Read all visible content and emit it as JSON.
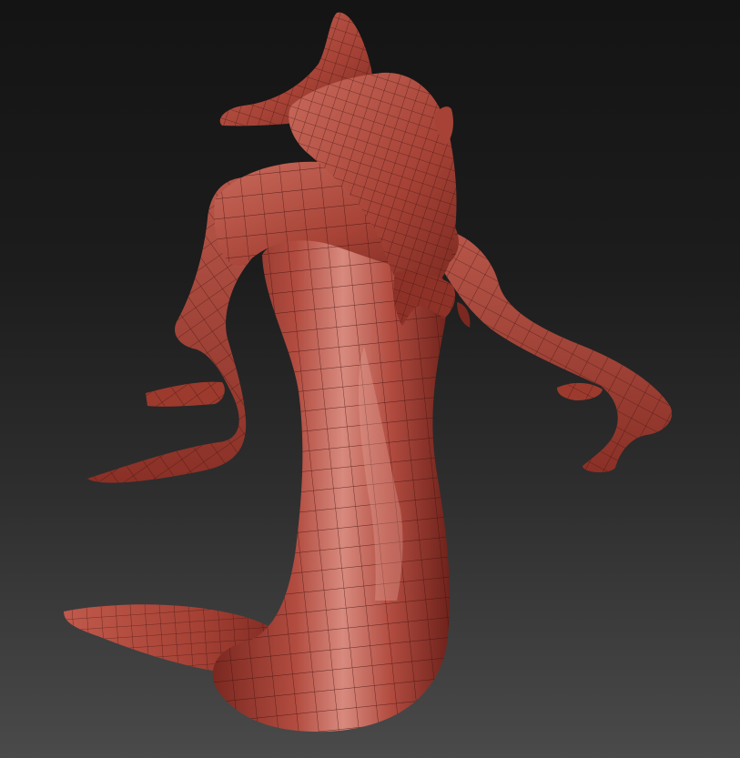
{
  "viewport": {
    "background_top": "#161616",
    "background_bottom": "#4a4a4a"
  },
  "model": {
    "subject": "serpent-creature-sculpt",
    "display": "polygroup-wireframe",
    "base_color": "#a84438",
    "highlight_color": "#d9857a",
    "shadow_color": "#5a1a14",
    "wire_color": "#3a0f0b"
  }
}
